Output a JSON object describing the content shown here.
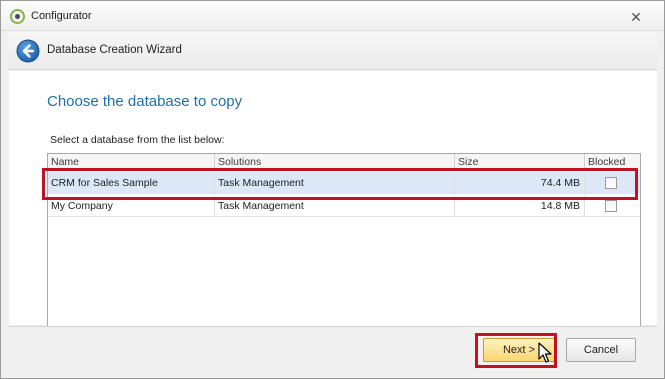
{
  "window": {
    "title": "Configurator",
    "close_glyph": "✕",
    "icon": "configurator-app-icon"
  },
  "wizard": {
    "title": "Database Creation Wizard",
    "back_icon": "back-arrow-circle-icon"
  },
  "page": {
    "heading": "Choose the database to copy",
    "instruction": "Select a database from the list below:"
  },
  "grid": {
    "columns": [
      "Name",
      "Solutions",
      "Size",
      "Blocked"
    ],
    "rows": [
      {
        "name": "CRM for Sales Sample",
        "solutions": "Task Management",
        "size": "74.4 MB",
        "blocked": false,
        "selected": true
      },
      {
        "name": "My Company",
        "solutions": "Task Management",
        "size": "14.8 MB",
        "blocked": false,
        "selected": false
      }
    ]
  },
  "footer": {
    "next_label": "Next >",
    "cancel_label": "Cancel"
  },
  "colors": {
    "heading": "#1f6ea8",
    "highlight": "#c1131f",
    "selected_row": "#dce8f7",
    "next_button": "#fbd56f"
  }
}
